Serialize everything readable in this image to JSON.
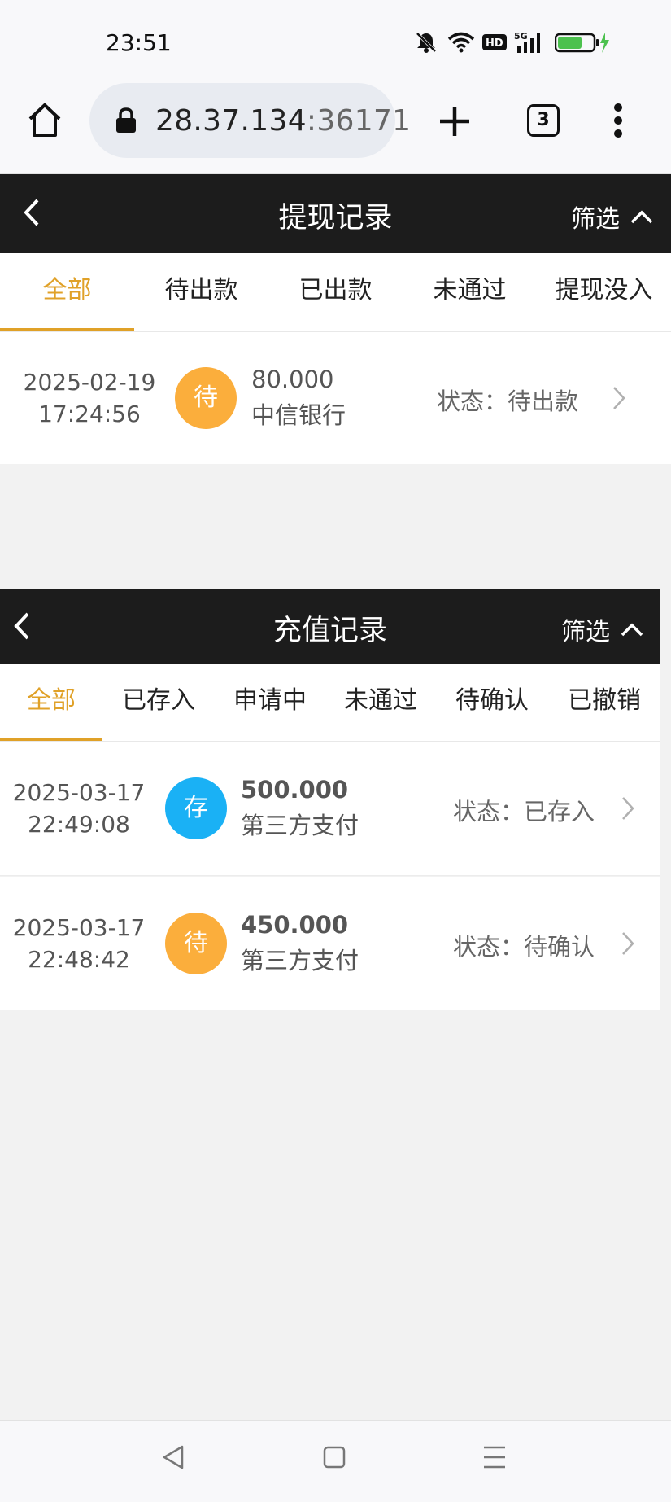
{
  "status_bar": {
    "time": "23:51",
    "icons": [
      "mute-bell-icon",
      "wifi-icon",
      "hd-icon",
      "5g-signal-icon",
      "battery-charging-icon"
    ],
    "hd_label": "HD",
    "network_label": "5G",
    "battery_level": 0.7
  },
  "browser": {
    "url_host": "28.37.134",
    "url_port": ":36171",
    "tab_count": "3",
    "icons": [
      "home-icon",
      "lock-icon",
      "plus-icon",
      "tabs-icon",
      "more-vert-icon"
    ]
  },
  "withdraw": {
    "title": "提现记录",
    "filter_label": "筛选",
    "tabs": [
      {
        "label": "全部",
        "active": true
      },
      {
        "label": "待出款",
        "active": false
      },
      {
        "label": "已出款",
        "active": false
      },
      {
        "label": "未通过",
        "active": false
      },
      {
        "label": "提现没入",
        "active": false
      }
    ],
    "records": [
      {
        "date": "2025-02-19",
        "time": "17:24:56",
        "badge": "待",
        "badge_color": "#fbae3c",
        "amount": "80.000",
        "method": "中信银行",
        "status": "状态：待出款"
      }
    ]
  },
  "deposit": {
    "title": "充值记录",
    "filter_label": "筛选",
    "tabs": [
      {
        "label": "全部",
        "active": true
      },
      {
        "label": "已存入",
        "active": false
      },
      {
        "label": "申请中",
        "active": false
      },
      {
        "label": "未通过",
        "active": false
      },
      {
        "label": "待确认",
        "active": false
      },
      {
        "label": "已撤销",
        "active": false
      }
    ],
    "records": [
      {
        "date": "2025-03-17",
        "time": "22:49:08",
        "badge": "存",
        "badge_color": "#1ab1f5",
        "amount": "500.000",
        "method": "第三方支付",
        "status": "状态：已存入"
      },
      {
        "date": "2025-03-17",
        "time": "22:48:42",
        "badge": "待",
        "badge_color": "#fbae3c",
        "amount": "450.000",
        "method": "第三方支付",
        "status": "状态：待确认"
      }
    ]
  },
  "nav": {
    "icons": [
      "back-triangle-icon",
      "home-square-icon",
      "recents-menu-icon"
    ]
  },
  "colors": {
    "accent": "#e0a128",
    "header_bg": "#1c1c1c",
    "pending": "#fbae3c",
    "deposited": "#1ab1f5"
  }
}
